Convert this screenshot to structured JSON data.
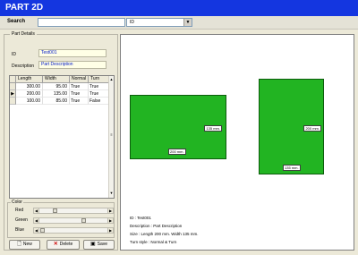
{
  "app": {
    "title": "PART 2D"
  },
  "search": {
    "label": "Search",
    "value": "",
    "field_option": "ID"
  },
  "details": {
    "legend": "Part Details",
    "id_label": "ID",
    "id_value": "Test001",
    "desc_label": "Description",
    "desc_value": "Part Description"
  },
  "grid": {
    "headers": [
      "Length",
      "Width",
      "Normal",
      "Turn"
    ],
    "selected_row": 1,
    "rows": [
      {
        "length": "300.00",
        "width": "95.00",
        "normal": "True",
        "turn": "True"
      },
      {
        "length": "200.00",
        "width": "135.00",
        "normal": "True",
        "turn": "True"
      },
      {
        "length": "100.00",
        "width": "85.00",
        "normal": "True",
        "turn": "False"
      }
    ]
  },
  "color": {
    "legend": "Color",
    "red_label": "Red",
    "green_label": "Green",
    "blue_label": "Blue",
    "red_level": 0.2,
    "green_level": 0.67,
    "blue_level": 0.0,
    "part_color": "#22b422"
  },
  "buttons": {
    "new_label": "New",
    "delete_label": "Delete",
    "save_label": "Save"
  },
  "preview": {
    "shape1": {
      "width_label": "135 mm.",
      "length_label": "200 mm."
    },
    "shape2": {
      "width_label": "200 mm.",
      "length_label": "135 mm."
    },
    "info": {
      "id_line": "ID : Test001",
      "desc_line": "Description : Part Description",
      "size_line": "Size : Length 200 mm. Width 135 mm.",
      "turn_line": "Turn style : Normal & Turn"
    }
  },
  "icons": {
    "new": "page-icon",
    "delete": "x-icon",
    "save": "floppy-disk-icon",
    "dropdown": "chevron-down-icon",
    "row_pointer": "row-pointer-icon"
  }
}
